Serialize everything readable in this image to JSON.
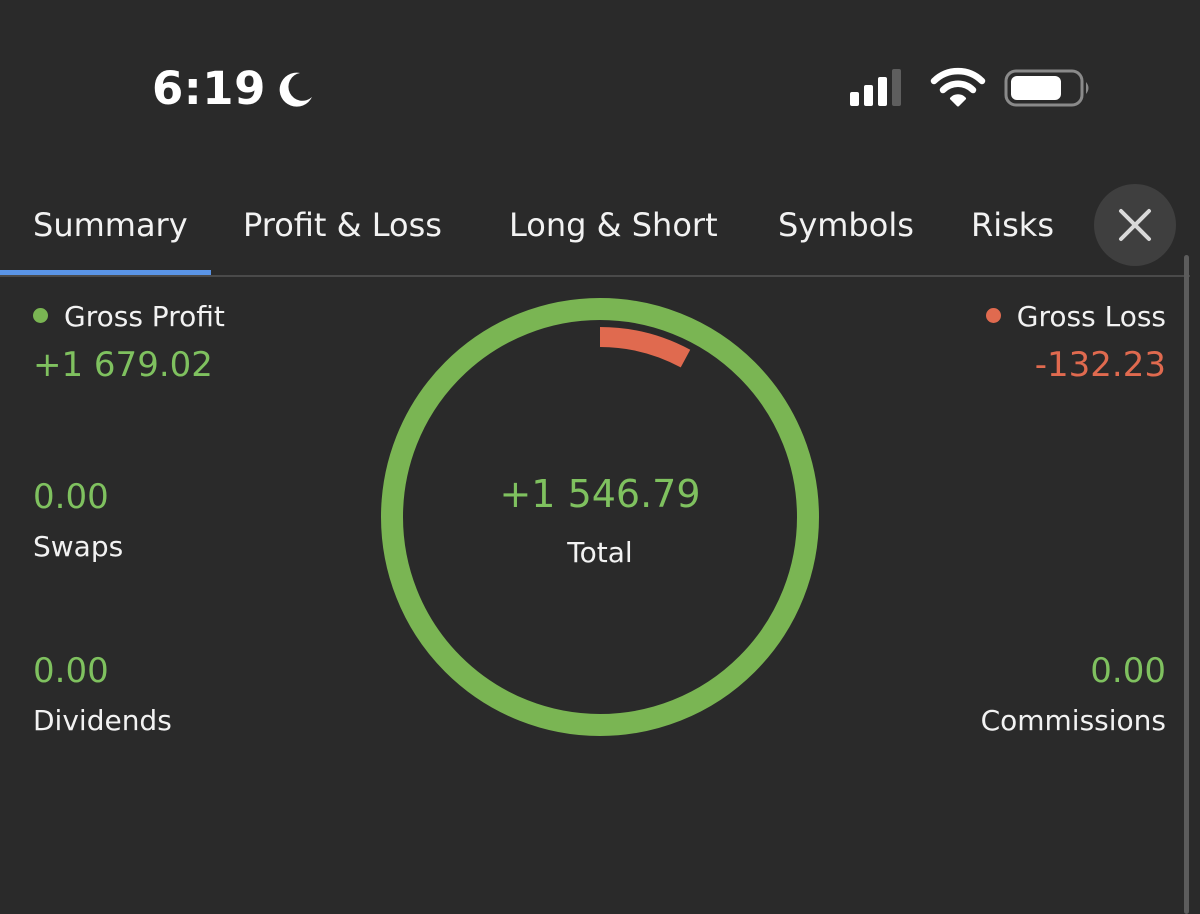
{
  "status_bar": {
    "time": "6:19",
    "icons": [
      "moon-icon",
      "cellular-signal-icon",
      "wifi-icon",
      "battery-icon"
    ]
  },
  "tabs": [
    {
      "label": "Summary",
      "active": true
    },
    {
      "label": "Profit & Loss",
      "active": false
    },
    {
      "label": "Long & Short",
      "active": false
    },
    {
      "label": "Symbols",
      "active": false
    },
    {
      "label": "Risks",
      "active": false
    }
  ],
  "close_icon": "close-icon",
  "summary": {
    "gross_profit": {
      "label": "Gross Profit",
      "value": "+1 679.02"
    },
    "gross_loss": {
      "label": "Gross Loss",
      "value": "-132.23"
    },
    "swaps": {
      "label": "Swaps",
      "value": "0.00"
    },
    "dividends": {
      "label": "Dividends",
      "value": "0.00"
    },
    "commissions": {
      "label": "Commissions",
      "value": "0.00"
    },
    "total": {
      "label": "Total",
      "value": "+1 546.79"
    }
  },
  "chart_data": {
    "type": "pie",
    "categories": [
      "Gross Profit",
      "Gross Loss"
    ],
    "values": [
      1679.02,
      132.23
    ],
    "title": "",
    "colors": {
      "profit": "#7ab553",
      "loss": "#e06a4f"
    }
  },
  "colors": {
    "background": "#2a2a2a",
    "positive": "#7fc15f",
    "negative": "#e06a4f",
    "accent": "#5a94e6"
  }
}
